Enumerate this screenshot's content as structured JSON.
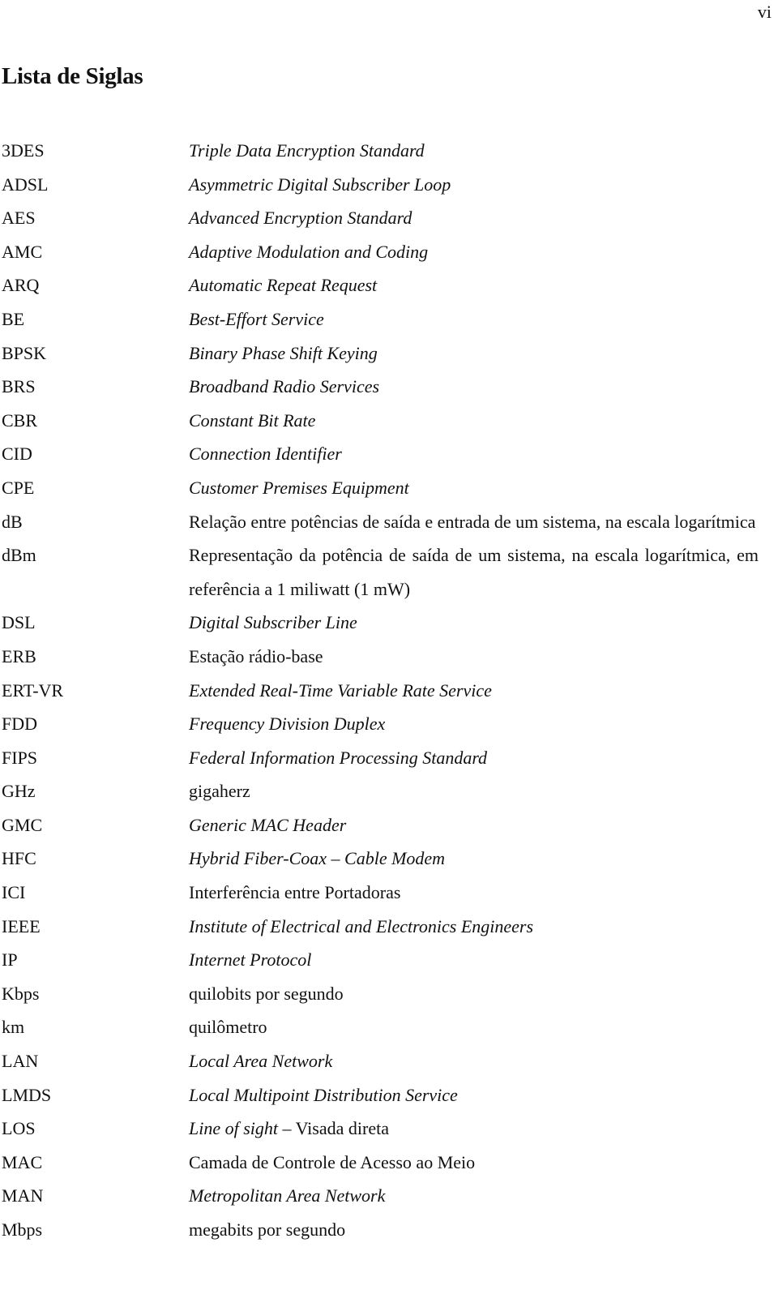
{
  "page": {
    "number": "vi",
    "title": "Lista de Siglas"
  },
  "siglas": [
    {
      "abbr": "3DES",
      "definition": "Triple Data Encryption Standard",
      "italic": true
    },
    {
      "abbr": "ADSL",
      "definition": "Asymmetric Digital Subscriber Loop",
      "italic": true
    },
    {
      "abbr": "AES",
      "definition": "Advanced Encryption Standard",
      "italic": true
    },
    {
      "abbr": "AMC",
      "definition": "Adaptive Modulation and Coding",
      "italic": true
    },
    {
      "abbr": "ARQ",
      "definition": "Automatic Repeat Request",
      "italic": true
    },
    {
      "abbr": "BE",
      "definition": "Best-Effort Service",
      "italic": true
    },
    {
      "abbr": "BPSK",
      "definition": "Binary Phase Shift Keying",
      "italic": true
    },
    {
      "abbr": "BRS",
      "definition": "Broadband Radio Services",
      "italic": true
    },
    {
      "abbr": "CBR",
      "definition": "Constant Bit Rate",
      "italic": true
    },
    {
      "abbr": "CID",
      "definition": "Connection Identifier",
      "italic": true
    },
    {
      "abbr": "CPE",
      "definition": "Customer Premises Equipment",
      "italic": true
    },
    {
      "abbr": "dB",
      "definition": "Relação entre potências de saída e entrada de um sistema, na escala logarítmica",
      "italic": false
    },
    {
      "abbr": "dBm",
      "definition": "Representação da potência de saída de um sistema, na escala logarítmica, em referência a 1 miliwatt (1 mW)",
      "italic": false
    },
    {
      "abbr": "DSL",
      "definition": "Digital Subscriber Line",
      "italic": true
    },
    {
      "abbr": "ERB",
      "definition": "Estação rádio-base",
      "italic": false
    },
    {
      "abbr": "ERT-VR",
      "definition": "Extended Real-Time Variable Rate Service",
      "italic": true
    },
    {
      "abbr": "FDD",
      "definition": "Frequency Division Duplex",
      "italic": true
    },
    {
      "abbr": "FIPS",
      "definition": "Federal Information  Processing Standard",
      "italic": true
    },
    {
      "abbr": "GHz",
      "definition": "gigaherz",
      "italic": false
    },
    {
      "abbr": "GMC",
      "definition": "Generic MAC Header",
      "italic": true
    },
    {
      "abbr": "HFC",
      "definition": "Hybrid Fiber-Coax – Cable Modem",
      "italic": true
    },
    {
      "abbr": "ICI",
      "definition": "Interferência entre Portadoras",
      "italic": false
    },
    {
      "abbr": "IEEE",
      "definition": "Institute of Electrical and Electronics Engineers",
      "italic": true
    },
    {
      "abbr": "IP",
      "definition": "Internet Protocol",
      "italic": true
    },
    {
      "abbr": "Kbps",
      "definition": "quilobits por segundo",
      "italic": false
    },
    {
      "abbr": "km",
      "definition": "quilômetro",
      "italic": false
    },
    {
      "abbr": "LAN",
      "definition": "Local Area Network",
      "italic": true
    },
    {
      "abbr": "LMDS",
      "definition": "Local Multipoint Distribution Service",
      "italic": true
    },
    {
      "abbr": "LOS",
      "definition_parts": [
        {
          "text": "Line of sight",
          "italic": true
        },
        {
          "text": " – Visada direta",
          "italic": false
        }
      ]
    },
    {
      "abbr": "MAC",
      "definition": "Camada de Controle de Acesso ao Meio",
      "italic": false
    },
    {
      "abbr": "MAN",
      "definition": "Metropolitan Area Network",
      "italic": true
    },
    {
      "abbr": "Mbps",
      "definition": "megabits por segundo",
      "italic": false
    }
  ]
}
